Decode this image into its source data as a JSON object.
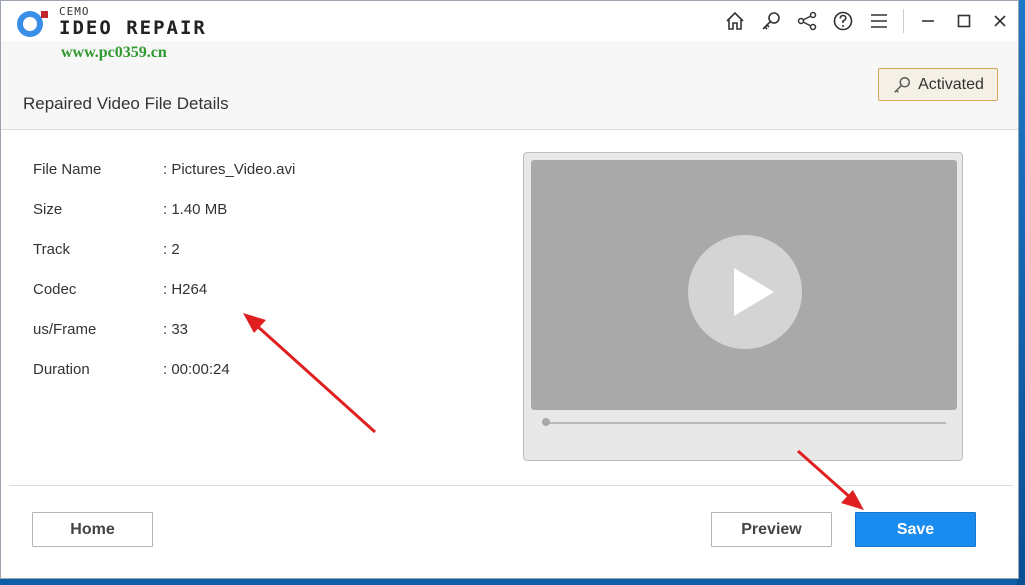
{
  "app": {
    "logo_top": "CEMO",
    "logo_name": "IDEO REPAIR",
    "watermark_url": "www.pc0359.cn"
  },
  "titlebar": {
    "icons": [
      "home-icon",
      "key-icon",
      "share-icon",
      "help-icon",
      "menu-icon",
      "minimize-icon",
      "maximize-icon",
      "close-icon"
    ]
  },
  "header": {
    "title": "Repaired Video File Details",
    "activated_label": "Activated"
  },
  "details": {
    "rows": [
      {
        "label": "File Name",
        "value": ": Pictures_Video.avi"
      },
      {
        "label": "Size",
        "value": ": 1.40 MB"
      },
      {
        "label": "Track",
        "value": ": 2"
      },
      {
        "label": "Codec",
        "value": ": H264"
      },
      {
        "label": "us/Frame",
        "value": ": 33"
      },
      {
        "label": "Duration",
        "value": ": 00:00:24"
      }
    ]
  },
  "player": {
    "progress": 0
  },
  "footer": {
    "home_label": "Home",
    "preview_label": "Preview",
    "save_label": "Save"
  },
  "colors": {
    "primary": "#1a8cf0",
    "activated_border": "#d5a85a",
    "annotation_arrow": "#e02020"
  }
}
